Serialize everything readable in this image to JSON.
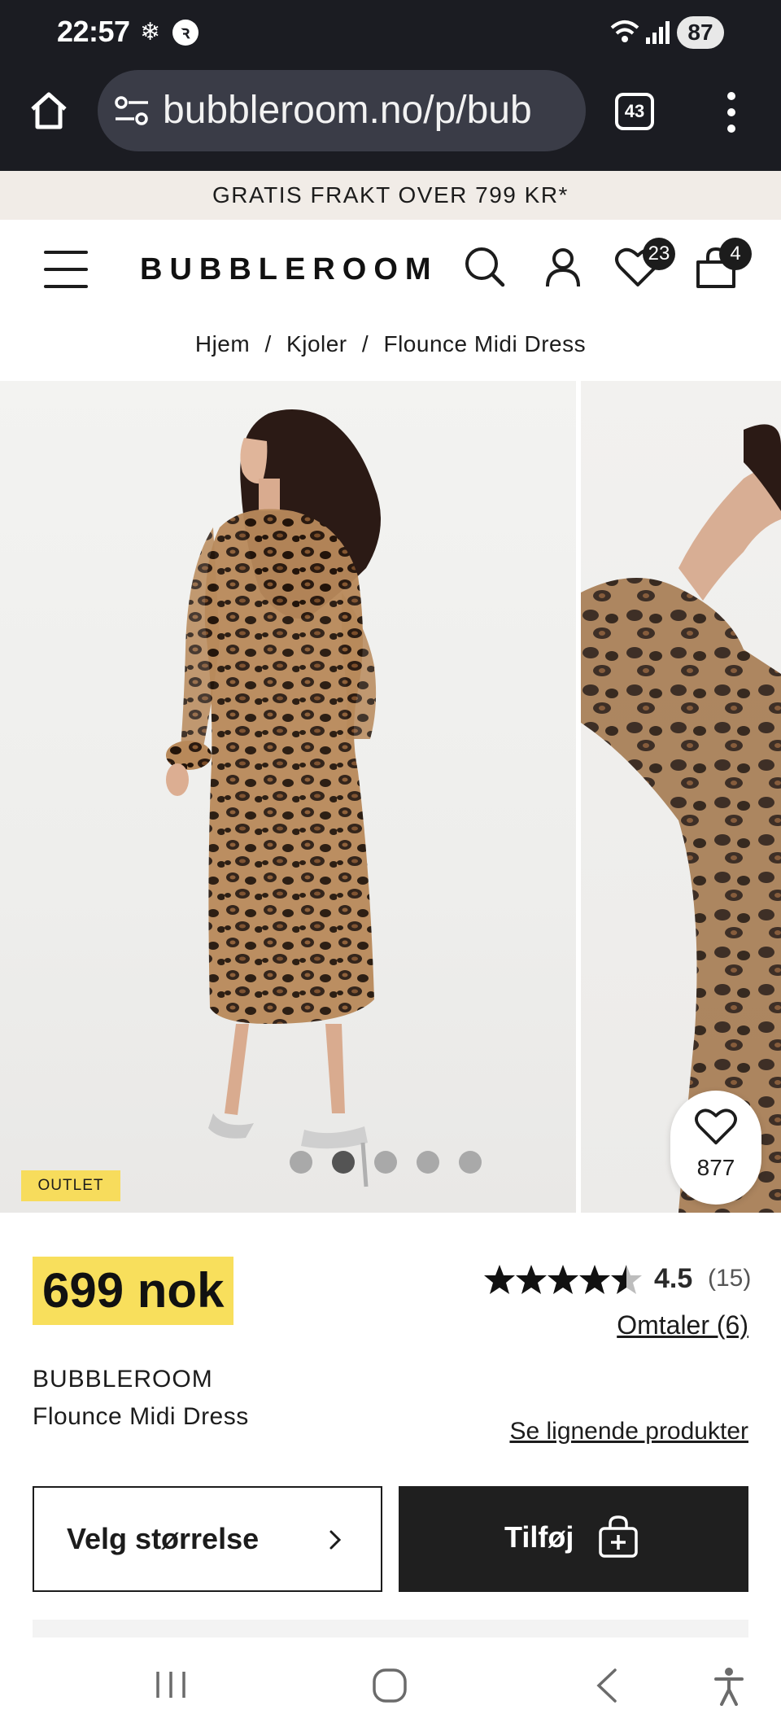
{
  "status_bar": {
    "time": "22:57",
    "battery": "87",
    "icons": [
      "snowflake-icon",
      "app-notification-icon",
      "wifi-icon",
      "signal-icon",
      "battery-icon"
    ]
  },
  "browser": {
    "url": "bubbleroom.no/p/bub",
    "tab_count": "43",
    "icons": [
      "home-icon",
      "site-settings-icon",
      "tabs-icon",
      "overflow-menu-icon"
    ]
  },
  "promo_banner": {
    "text": "GRATIS FRAKT OVER 799 KR*"
  },
  "header": {
    "logo": "BUBBLEROOM",
    "wishlist_count": "23",
    "cart_count": "4",
    "icons": [
      "menu-icon",
      "search-icon",
      "account-icon",
      "heart-icon",
      "bag-icon"
    ]
  },
  "breadcrumb": {
    "items": [
      "Hjem",
      "Kjoler",
      "Flounce Midi Dress"
    ],
    "separator": "/"
  },
  "gallery": {
    "badge": "OUTLET",
    "favorites_count": "877",
    "dot_count": 5,
    "active_dot": 1
  },
  "product": {
    "price": "699 nok",
    "rating_value": "4.5",
    "rating_count": "(15)",
    "rating_stars": 4.5,
    "reviews_link": "Omtaler (6)",
    "brand": "BUBBLEROOM",
    "name": "Flounce Midi Dress",
    "similar_link": "Se lignende produkter",
    "size_button": "Velg størrelse",
    "add_button": "Tilføj"
  },
  "colors": {
    "dark_chrome": "#1b1c22",
    "promo_bg": "#f1ece7",
    "price_highlight": "#f8df5c",
    "primary_button": "#1f1f1f"
  },
  "nav_bar": {
    "icons": [
      "recent-apps-icon",
      "home-nav-icon",
      "back-icon",
      "accessibility-icon"
    ]
  }
}
